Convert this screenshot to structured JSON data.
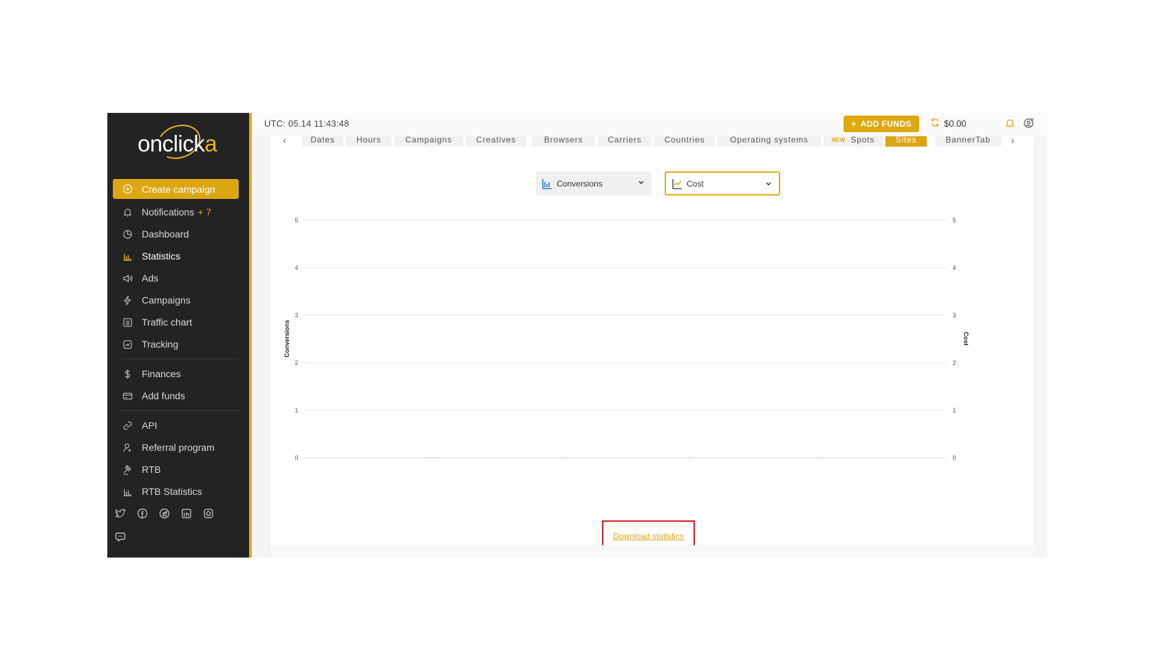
{
  "brand": {
    "logo": "onclicka",
    "accent": "#dca613",
    "sidebar_bg": "#232323"
  },
  "sidebar": {
    "primary": {
      "label": "Create campaign",
      "icon": "plus-circle-icon"
    },
    "items": [
      {
        "label": "Notifications",
        "badge": "+ 7",
        "icon": "bell-icon"
      },
      {
        "label": "Dashboard",
        "icon": "pie-chart-icon"
      },
      {
        "label": "Statistics",
        "icon": "bar-chart-icon",
        "active": true
      },
      {
        "label": "Ads",
        "icon": "speaker-icon"
      },
      {
        "label": "Campaigns",
        "icon": "lightning-icon"
      },
      {
        "label": "Traffic chart",
        "icon": "list-icon"
      },
      {
        "label": "Tracking",
        "icon": "trend-icon"
      },
      {
        "label": "Finances",
        "icon": "dollar-icon"
      },
      {
        "label": "Add funds",
        "icon": "card-icon"
      },
      {
        "label": "API",
        "icon": "link-icon"
      },
      {
        "label": "Referral program",
        "icon": "user-plus-icon"
      },
      {
        "label": "RTB",
        "icon": "gavel-icon"
      },
      {
        "label": "RTB Statistics",
        "icon": "bar-chart-icon"
      }
    ],
    "socials": [
      "twitter-icon",
      "facebook-icon",
      "telegram-icon",
      "linkedin-icon",
      "instagram-icon",
      "chat-icon"
    ]
  },
  "topbar": {
    "utc": "UTC: 05.14 11:43:48",
    "add_funds": "ADD FUNDS",
    "balance": "$0.00"
  },
  "tabs": [
    {
      "label": "Dates"
    },
    {
      "label": "Hours"
    },
    {
      "label": "Campaigns"
    },
    {
      "label": "Creatives"
    },
    {
      "label": "Browsers"
    },
    {
      "label": "Carriers"
    },
    {
      "label": "Countries"
    },
    {
      "label": "Operating systems"
    },
    {
      "label": "Spots",
      "new": "NEW"
    },
    {
      "label": "Sites",
      "active": true
    },
    {
      "label": "BannerTab"
    }
  ],
  "selects": {
    "left": {
      "value": "Conversions",
      "icon": "bar-chart-icon"
    },
    "right": {
      "value": "Cost",
      "icon": "line-chart-icon"
    }
  },
  "chart_data": {
    "type": "line",
    "x": [],
    "series": [],
    "ylabel_left": "Conversions",
    "ylabel_right": "Cost",
    "ylim": [
      0,
      5
    ],
    "yticks": [
      0,
      1,
      2,
      3,
      4,
      5
    ],
    "grid": true
  },
  "download": {
    "label": "Download statistics"
  }
}
